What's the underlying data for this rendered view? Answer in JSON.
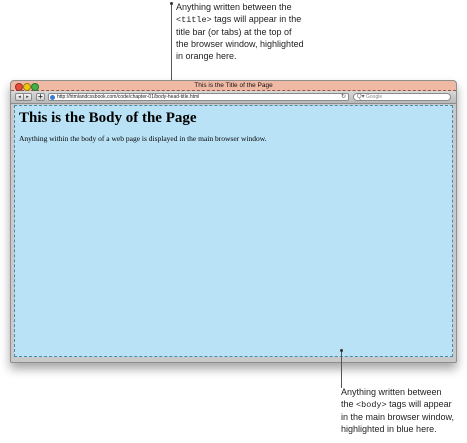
{
  "annotations": {
    "top": {
      "line1": "Anything written between the",
      "line2_tag": "<title>",
      "line2_rest": " tags will appear in the",
      "line3": "title bar (or tabs) at the top of",
      "line4": "the browser window, highlighted",
      "line5": "in orange here."
    },
    "bottom": {
      "line1": "Anything written between",
      "line2_pre": "the ",
      "line2_tag": "<body>",
      "line2_rest": " tags will appear",
      "line3": "in the main browser window,",
      "line4": "highlighted in blue here."
    }
  },
  "browser": {
    "title": "This is the Title of the Page",
    "url": "http://htmlandcssbook.com/code/chapter-01/body-head-title.html",
    "search_placeholder": "Google",
    "nav": {
      "back_glyph": "◂",
      "forward_glyph": "▸",
      "add_glyph": "+",
      "reload_glyph": "↻",
      "search_glyph": "Q▾"
    },
    "icons": {
      "close": "close-icon",
      "minimize": "minimize-icon",
      "maximize": "maximize-icon"
    }
  },
  "page": {
    "heading": "This is the Body of the Page",
    "paragraph": "Anything within the body of a web page is displayed in the main browser window."
  },
  "colors": {
    "title_highlight": "#f0b9a4",
    "body_highlight": "#bae2f6"
  }
}
